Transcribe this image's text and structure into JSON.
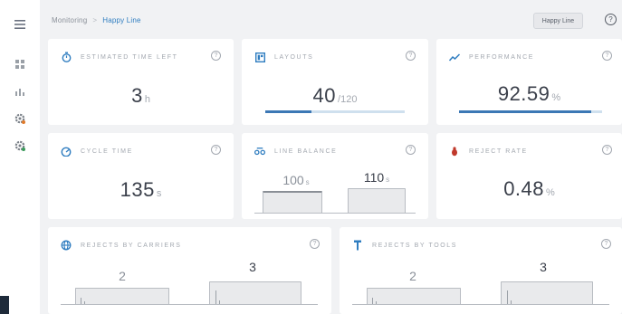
{
  "sidebar": {
    "icons": [
      "menu-icon",
      "grid-icon",
      "bar-chart-icon",
      "settings-icon",
      "settings-alert-icon"
    ]
  },
  "header": {
    "breadcrumb": {
      "root": "Monitoring",
      "separator": ">",
      "current": "Happy Line"
    },
    "line_button": "Happy Line",
    "help": "?"
  },
  "cards": {
    "estimated_time": {
      "title": "ESTIMATED TIME LEFT",
      "value": "3",
      "unit": "h",
      "icon": "stopwatch-icon"
    },
    "layouts": {
      "title": "LAYOUTS",
      "value": "40",
      "unit": "/120",
      "progress": 0.333,
      "icon": "layout-icon"
    },
    "performance": {
      "title": "PERFORMANCE",
      "value": "92.59",
      "unit": "%",
      "progress": 0.9259,
      "icon": "trend-icon"
    },
    "cycle_time": {
      "title": "CYCLE TIME",
      "value": "135",
      "unit": "s",
      "icon": "gauge-icon"
    },
    "line_balance": {
      "title": "LINE BALANCE",
      "icon": "balance-icon",
      "stations": [
        {
          "value": "100",
          "unit": "s"
        },
        {
          "value": "110",
          "unit": "s"
        }
      ]
    },
    "reject_rate": {
      "title": "REJECT RATE",
      "value": "0.48",
      "unit": "%",
      "icon": "bug-icon"
    },
    "rejects_carriers": {
      "title": "REJECTS BY CARRIERS",
      "icon": "globe-icon",
      "values": [
        "2",
        "3"
      ]
    },
    "rejects_tools": {
      "title": "REJECTS BY TOOLS",
      "icon": "tool-icon",
      "values": [
        "2",
        "3"
      ]
    }
  },
  "colors": {
    "accent": "#2f7dc0",
    "progress_fill": "#3c78b5",
    "progress_track": "#cfe0ee",
    "reject_icon": "#c0392b",
    "background": "#f1f2f4"
  }
}
